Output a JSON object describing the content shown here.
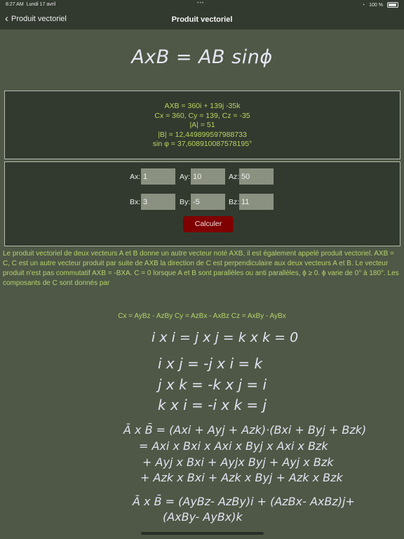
{
  "status": {
    "time": "8:27 AM",
    "date": "Lundi 17 avril",
    "battery": "100 %"
  },
  "nav": {
    "back_label": "Produit vectoriel",
    "title": "Produit vectoriel"
  },
  "formula_main": "AxB = AB sinϕ",
  "results": [
    "AXB = 360i + 139j  -35k",
    "Cx = 360, Cy = 139, Cz = -35",
    "|A| = 51",
    "|B| = 12,449899597988733",
    "sin φ  = 37,608910087578195°"
  ],
  "inputs": {
    "ax_label": "Ax:",
    "ax": "1",
    "ay_label": "Ay:",
    "ay": "10",
    "az_label": "Az:",
    "az": "50",
    "bx_label": "Bx:",
    "bx": "3",
    "by_label": "By:",
    "by": "-5",
    "bz_label": "Bz:",
    "bz": "11"
  },
  "calc_button": "Calculer",
  "description": "Le produit vectoriel de deux vecteurs A et B donne un autre vecteur noté AXB, il est également appelé produit vectoriel. AXB = C, C est un autre vecteur produit par suite de AXB la direction de C est perpendiculaire aux deux vecteurs A et B. Le vecteur produit n'est pas commutatif AXB = -BXA. C = 0 lorsque A et B sont parallèles ou anti parallèles, ϕ ≥ 0. ϕ varie de 0° à 180°. Les composants de C sont donnés par",
  "components_line": "Cx = AyBz - AzBy    Cy = AzBx - AxBz   Cz = AxBy - AyBx",
  "identities": [
    "i x i  = j x j  = k x k = 0",
    "i x j  = -j x i  = k",
    "j x k = -k x j = i",
    "k x i = -i x k = j"
  ],
  "expansion": [
    "Ā x B̄ = (Axi + Ayj + Azk)·(Bxi + Byj + Bzk)",
    "= Axi x Bxi x Axi x Byj x Axi x Bzk",
    "+ Ayj x Bxi + Ayjx Byj +  Ayj x Bzk",
    "+ Azk x Bxi + Azk x Byj +  Azk x Bzk"
  ],
  "result_formula": [
    "Ā x B̄ = (AyBz- AzBy)i + (AzBx- AxBz)j+",
    "(AxBy- AyBx)k"
  ]
}
